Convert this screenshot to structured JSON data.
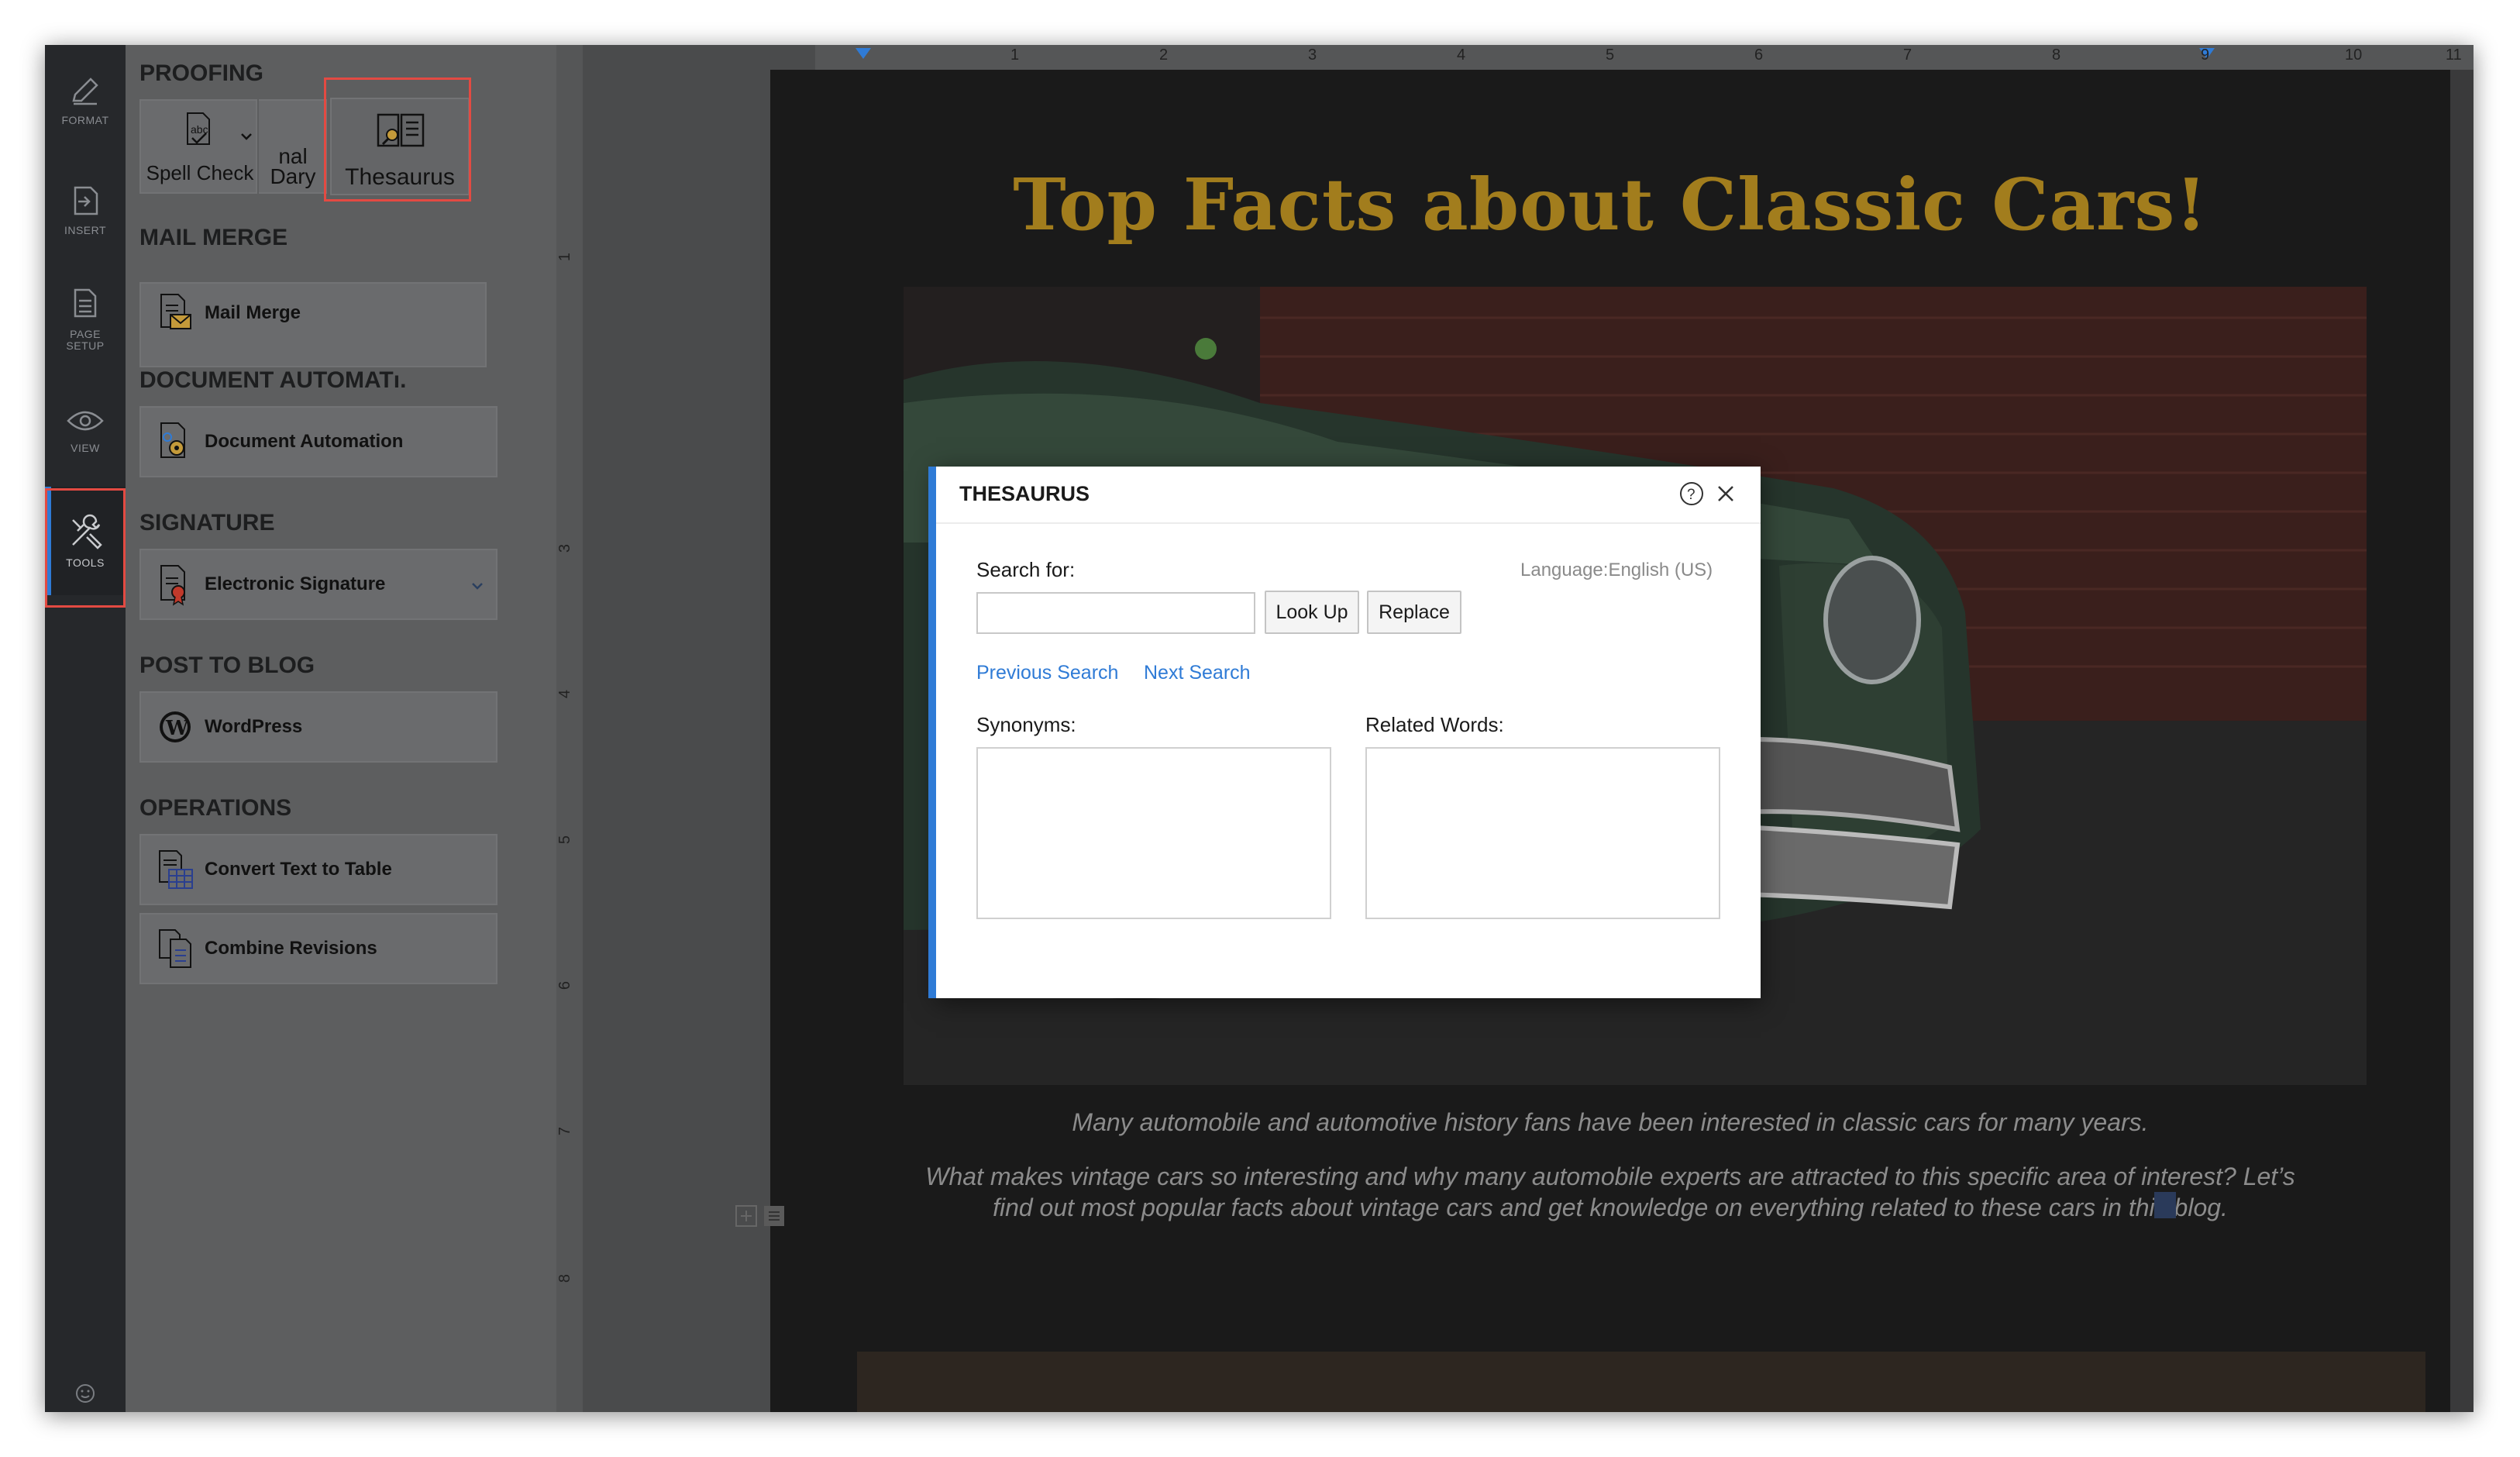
{
  "rail": {
    "items": [
      {
        "label": "FORMAT",
        "icon": "pen-icon"
      },
      {
        "label": "INSERT",
        "icon": "insert-icon"
      },
      {
        "label": "PAGE SETUP",
        "icon": "page-setup-icon"
      },
      {
        "label": "VIEW",
        "icon": "eye-icon"
      },
      {
        "label": "TOOLS",
        "icon": "tools-icon"
      }
    ]
  },
  "panel": {
    "proofing": {
      "title": "PROOFING",
      "spell_check": "Spell Check",
      "dictionary_top": "nal",
      "dictionary_bottom": "Dary",
      "thesaurus": "Thesaurus"
    },
    "mail_merge": {
      "title": "MAIL MERGE",
      "button": "Mail Merge"
    },
    "document_automation": {
      "title": "DOCUMENT AUTOMATı.",
      "button": "Document Automation"
    },
    "signature": {
      "title": "SIGNATURE",
      "button": "Electronic Signature"
    },
    "post_to_blog": {
      "title": "POST TO BLOG",
      "button": "WordPress"
    },
    "operations": {
      "title": "OPERATIONS",
      "convert": "Convert Text to Table",
      "combine": "Combine Revisions"
    }
  },
  "ruler": {
    "horizontal": [
      "1",
      "2",
      "3",
      "4",
      "5",
      "6",
      "7",
      "8",
      "9",
      "10",
      "11"
    ],
    "vertical": [
      "1",
      "3",
      "4",
      "5",
      "6",
      "7",
      "8"
    ]
  },
  "document": {
    "title": "Top Facts about Classic Cars!",
    "paragraph1": "Many automobile and automotive history fans have been interested in classic cars for many years.",
    "paragraph2_line1": "What makes vintage cars so interesting and why many automobile experts are attracted to this specific area of interest? Let’s",
    "paragraph2_line2": "find out most popular facts about vintage cars and get knowledge on everything related to these cars in this blog."
  },
  "dialog": {
    "title": "THESAURUS",
    "search_label": "Search for:",
    "search_value": "",
    "language": "Language:English (US)",
    "look_up": "Look Up",
    "replace": "Replace",
    "previous_search": "Previous Search",
    "next_search": "Next Search",
    "synonyms_label": "Synonyms:",
    "related_label": "Related Words:"
  },
  "colors": {
    "accent": "#2f7bd6",
    "highlight": "#e34a42",
    "title_gold": "#a27d1d"
  }
}
